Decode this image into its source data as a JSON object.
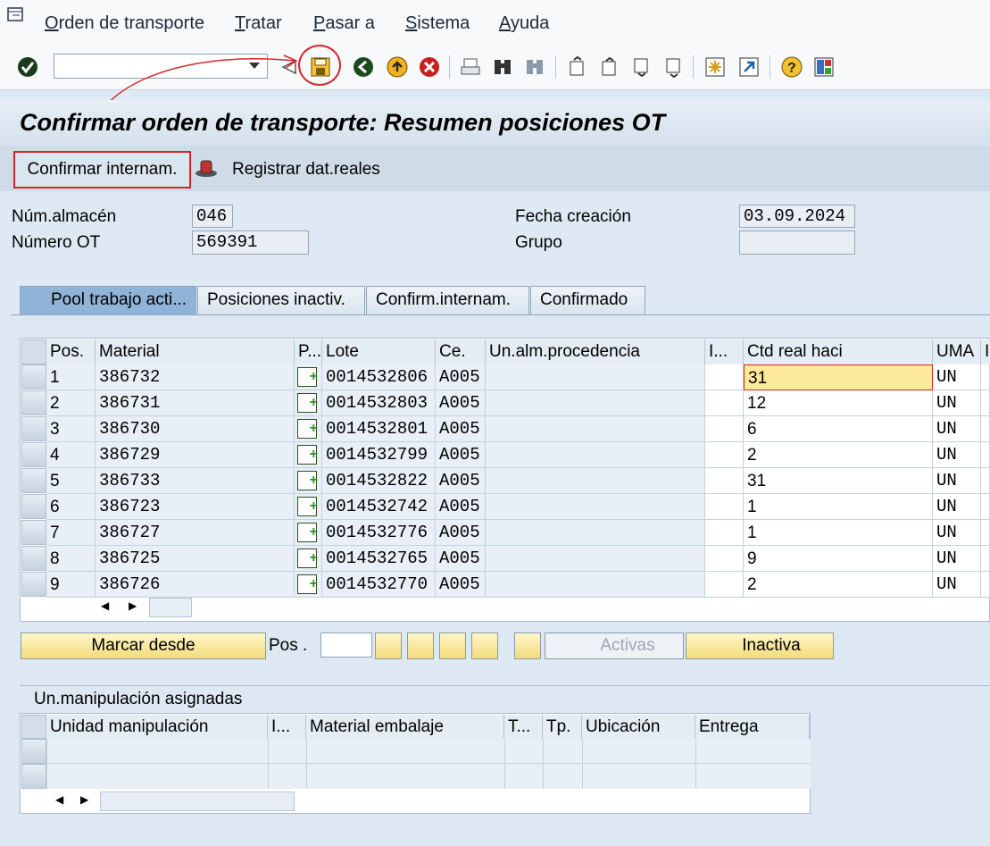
{
  "menu": {
    "items": [
      "Orden de transporte",
      "Tratar",
      "Pasar a",
      "Sistema",
      "Ayuda"
    ]
  },
  "toolbar": {
    "command_value": ""
  },
  "page": {
    "title": "Confirmar orden de transporte: Resumen posiciones OT"
  },
  "app_toolbar": {
    "confirm_btn": "Confirmar internam.",
    "register_btn": "Registrar dat.reales"
  },
  "header": {
    "warehouse_label": "Núm.almacén",
    "warehouse_value": "046",
    "to_label": "Número OT",
    "to_value": "569391",
    "date_label": "Fecha creación",
    "date_value": "03.09.2024",
    "group_label": "Grupo",
    "group_value": ""
  },
  "tabs": [
    "Pool trabajo acti...",
    "Posiciones inactiv.",
    "Confirm.internam.",
    "Confirmado"
  ],
  "table": {
    "columns": [
      "Pos.",
      "Material",
      "P...",
      "Lote",
      "Ce.",
      "Un.alm.procedencia",
      "I...",
      "Ctd real haci",
      "UMA",
      "I"
    ],
    "rows": [
      [
        "1",
        "386732",
        "0014532806",
        "A005",
        "",
        "31",
        "UN"
      ],
      [
        "2",
        "386731",
        "0014532803",
        "A005",
        "",
        "12",
        "UN"
      ],
      [
        "3",
        "386730",
        "0014532801",
        "A005",
        "",
        "6",
        "UN"
      ],
      [
        "4",
        "386729",
        "0014532799",
        "A005",
        "",
        "2",
        "UN"
      ],
      [
        "5",
        "386733",
        "0014532822",
        "A005",
        "",
        "31",
        "UN"
      ],
      [
        "6",
        "386723",
        "0014532742",
        "A005",
        "",
        "1",
        "UN"
      ],
      [
        "7",
        "386727",
        "0014532776",
        "A005",
        "",
        "1",
        "UN"
      ],
      [
        "8",
        "386725",
        "0014532765",
        "A005",
        "",
        "9",
        "UN"
      ],
      [
        "9",
        "386726",
        "0014532770",
        "A005",
        "",
        "2",
        "UN"
      ]
    ]
  },
  "actions": {
    "mark_from": "Marcar desde",
    "pos_label": "Pos .",
    "pos_value": "",
    "active": "Activas",
    "inactive": "Inactiva"
  },
  "hu": {
    "section_title": "Un.manipulación asignadas",
    "columns": [
      "Unidad manipulación",
      "I...",
      "Material embalaje",
      "T...",
      "Tp.",
      "Ubicación",
      "Entrega"
    ]
  },
  "colors": {
    "highlight": "#d6262a",
    "selected_cell": "#fde99a"
  }
}
